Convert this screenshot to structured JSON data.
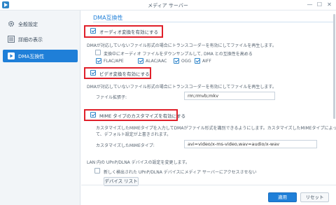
{
  "window": {
    "title": "メディア サーバー",
    "minimize": "—",
    "maximize": "☐",
    "close": "✕"
  },
  "sidebar": {
    "items": [
      {
        "label": "全般設定",
        "icon": "gear-icon"
      },
      {
        "label": "詳細の表示",
        "icon": "list-icon"
      },
      {
        "label": "DMA互換性",
        "icon": "play-icon",
        "active": true
      }
    ]
  },
  "main": {
    "section_title": "DMA互換性",
    "audio": {
      "checkbox_label": "オーディオ変換を有効にする",
      "desc": "DMAが対応していないファイル形式の場合にトランスコーダーを有効にしてファイルを再生します。",
      "downsample_label": "変換中にオーディオ ファイルをダウンサンプルして, DMA との互換性を高める",
      "formats": [
        {
          "label": "FLAC/APE",
          "checked": true
        },
        {
          "label": "ALAC/AAC",
          "checked": true
        },
        {
          "label": "OGG",
          "checked": true
        },
        {
          "label": "AIFF",
          "checked": true
        }
      ]
    },
    "video": {
      "checkbox_label": "ビデオ変換を有効にする",
      "desc": "DMAが対応していないファイル形式の場合にトランスコーダーを有効にしてファイルを再生します。",
      "ext_label": "ファイル拡張子:",
      "ext_value": "rm;rmvb;mkv"
    },
    "mime": {
      "checkbox_label": "MIME タイプのカスタマイズを有効にする",
      "desc1": "カスタマイズしたMIMEタイプを入力してDMAがファイル形式を識別できるようにします。カスタマイズしたMIMEタイプによっ",
      "desc2": "て、デフォルト設定が上書きされます。",
      "field_label": "カスタマイズしたMIMEタイプ:",
      "field_value": "avi=video/x-ms-video,wav=audio/x-wav"
    },
    "upnp": {
      "desc": "LAN 内の UPnP/DLNA デバイスの設定を変更します。",
      "checkbox_label": "新しく検出された UPnP/DLNA デバイスにメディア サーバーにアクセスさせない",
      "device_list_button": "デバイス リスト"
    },
    "footer": {
      "apply": "適用",
      "reset": "リセット"
    }
  }
}
